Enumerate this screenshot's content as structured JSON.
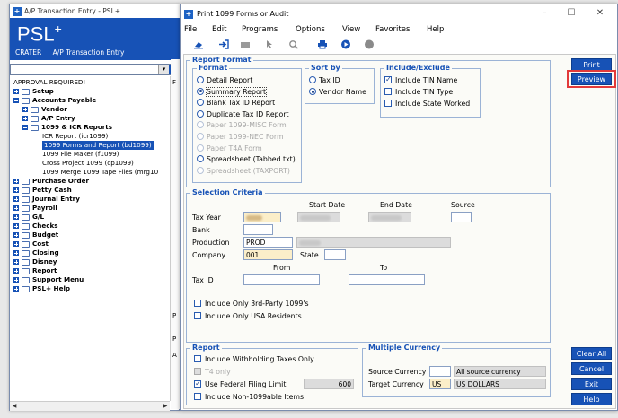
{
  "background_window": {
    "title": "A/P Transaction Entry - PSL+",
    "logo_text": "PSL+",
    "crumb_user": "CRATER",
    "crumb_module": "A/P Transaction Entry",
    "tree": [
      {
        "label": "APPROVAL REQUIRED!",
        "level": 0,
        "bold": false,
        "expander": "none"
      },
      {
        "label": "Setup",
        "level": 0,
        "bold": true,
        "expander": "plus"
      },
      {
        "label": "Accounts Payable",
        "level": 0,
        "bold": true,
        "expander": "minus"
      },
      {
        "label": "Vendor",
        "level": 1,
        "bold": true,
        "expander": "plus"
      },
      {
        "label": "A/P Entry",
        "level": 1,
        "bold": true,
        "expander": "plus"
      },
      {
        "label": "1099 & ICR Reports",
        "level": 1,
        "bold": true,
        "expander": "minus"
      },
      {
        "label": "ICR Report (icr1099)",
        "level": 2,
        "bold": false,
        "expander": "none"
      },
      {
        "label": "1099 Forms and Report (bd1099)",
        "level": 2,
        "bold": false,
        "expander": "none",
        "selected": true
      },
      {
        "label": "1099 File Maker (f1099)",
        "level": 2,
        "bold": false,
        "expander": "none"
      },
      {
        "label": "Cross Project 1099 (cp1099)",
        "level": 2,
        "bold": false,
        "expander": "none"
      },
      {
        "label": "1099 Merge 1099 Tape Files (mrg10",
        "level": 2,
        "bold": false,
        "expander": "none"
      },
      {
        "label": "Purchase Order",
        "level": 0,
        "bold": true,
        "expander": "plus"
      },
      {
        "label": "Petty Cash",
        "level": 0,
        "bold": true,
        "expander": "plus"
      },
      {
        "label": "Journal Entry",
        "level": 0,
        "bold": true,
        "expander": "plus"
      },
      {
        "label": "Payroll",
        "level": 0,
        "bold": true,
        "expander": "plus"
      },
      {
        "label": "G/L",
        "level": 0,
        "bold": true,
        "expander": "plus"
      },
      {
        "label": "Checks",
        "level": 0,
        "bold": true,
        "expander": "plus"
      },
      {
        "label": "Budget",
        "level": 0,
        "bold": true,
        "expander": "plus"
      },
      {
        "label": "Cost",
        "level": 0,
        "bold": true,
        "expander": "plus"
      },
      {
        "label": "Closing",
        "level": 0,
        "bold": true,
        "expander": "plus"
      },
      {
        "label": "Disney",
        "level": 0,
        "bold": true,
        "expander": "plus"
      },
      {
        "label": "Report",
        "level": 0,
        "bold": true,
        "expander": "plus"
      },
      {
        "label": "Support Menu",
        "level": 0,
        "bold": true,
        "expander": "plus"
      },
      {
        "label": "PSL+ Help",
        "level": 0,
        "bold": true,
        "expander": "plus"
      }
    ],
    "strip_letters": [
      "F",
      "P",
      "P",
      "A"
    ]
  },
  "dialog": {
    "title": "Print 1099 Forms or Audit",
    "window_buttons": [
      "–",
      "☐",
      "✕"
    ],
    "menu": [
      "File",
      "Edit",
      "Programs",
      "Options",
      "View",
      "Favorites",
      "Help"
    ],
    "toolbar_icons": [
      "eraser-icon",
      "exit-icon",
      "keyboard-icon",
      "pointer-icon",
      "zoom-icon",
      "printer-icon",
      "play-icon",
      "stop-icon"
    ],
    "report_format": {
      "title": "Report Format",
      "format_title": "Format",
      "formats": [
        {
          "label": "Detail Report",
          "selected": false,
          "enabled": true
        },
        {
          "label": "Summary Report",
          "selected": true,
          "enabled": true
        },
        {
          "label": "Blank Tax ID Report",
          "selected": false,
          "enabled": true
        },
        {
          "label": "Duplicate Tax ID Report",
          "selected": false,
          "enabled": true
        },
        {
          "label": "Paper 1099-MISC Form",
          "selected": false,
          "enabled": false
        },
        {
          "label": "Paper 1099-NEC Form",
          "selected": false,
          "enabled": false
        },
        {
          "label": "Paper T4A Form",
          "selected": false,
          "enabled": false
        },
        {
          "label": "Spreadsheet (Tabbed txt)",
          "selected": false,
          "enabled": true
        },
        {
          "label": "Spreadsheet (TAXPORT)",
          "selected": false,
          "enabled": false
        }
      ],
      "sortby_title": "Sort by",
      "sortby": [
        {
          "label": "Tax ID",
          "selected": false
        },
        {
          "label": "Vendor Name",
          "selected": true
        }
      ],
      "include_title": "Include/Exclude",
      "include": [
        {
          "label": "Include TIN Name",
          "checked": true
        },
        {
          "label": "Include TIN Type",
          "checked": false
        },
        {
          "label": "Include State Worked",
          "checked": false
        }
      ]
    },
    "selection": {
      "title": "Selection Criteria",
      "start_date": "Start Date",
      "end_date": "End Date",
      "source": "Source",
      "tax_year": "Tax Year",
      "bank": "Bank",
      "production": "Production",
      "production_value": "PROD",
      "company": "Company",
      "company_value": "001",
      "state": "State",
      "from": "From",
      "to": "To",
      "tax_id": "Tax ID",
      "only_3rd_party": "Include Only 3rd-Party 1099's",
      "only_usa": "Include Only USA Residents"
    },
    "report": {
      "title": "Report",
      "withholding": "Include Withholding Taxes Only",
      "t4": "T4 only",
      "federal_limit": "Use Federal Filing Limit",
      "federal_limit_value": "600",
      "non_1099": "Include Non-1099able Items"
    },
    "currency": {
      "title": "Multiple Currency",
      "source_label": "Source Currency",
      "source_desc": "All source currency",
      "target_label": "Target Currency",
      "target_code": "US",
      "target_desc": "US DOLLARS"
    },
    "buttons": {
      "print": "Print",
      "preview": "Preview",
      "clear_all": "Clear All",
      "cancel": "Cancel",
      "exit": "Exit",
      "help": "Help"
    },
    "accent_color": "#1752b6",
    "highlight_color": "#e23a3a"
  }
}
